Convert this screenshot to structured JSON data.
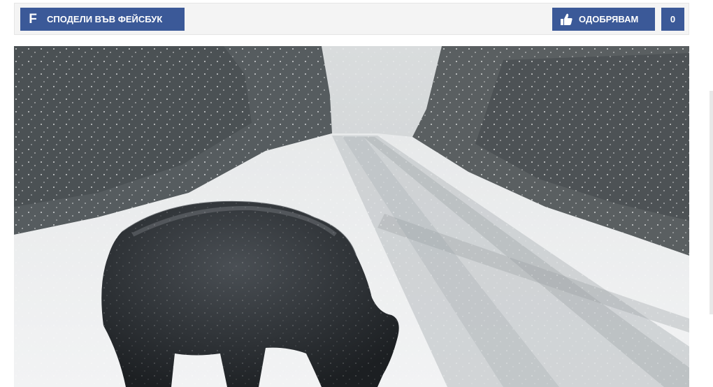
{
  "share": {
    "label": "СПОДЕЛИ ВЪВ ФЕЙСБУК",
    "icon": "facebook-icon"
  },
  "like": {
    "label": "ОДОБРЯВАМ",
    "icon": "thumbs-up-icon",
    "count": "0"
  },
  "colors": {
    "facebook_blue": "#3b5998"
  }
}
